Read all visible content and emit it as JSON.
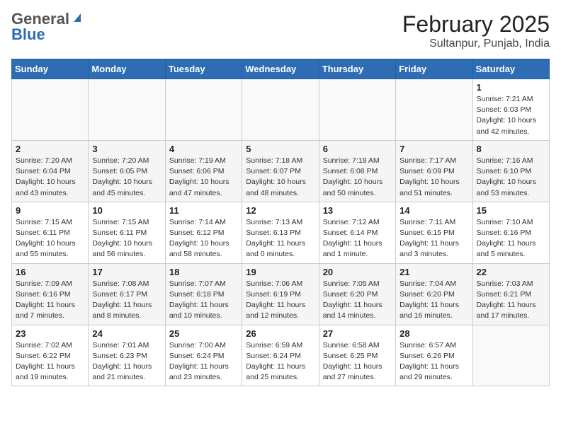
{
  "header": {
    "logo_general": "General",
    "logo_blue": "Blue",
    "title": "February 2025",
    "subtitle": "Sultanpur, Punjab, India"
  },
  "weekdays": [
    "Sunday",
    "Monday",
    "Tuesday",
    "Wednesday",
    "Thursday",
    "Friday",
    "Saturday"
  ],
  "weeks": [
    [
      {
        "day": "",
        "info": ""
      },
      {
        "day": "",
        "info": ""
      },
      {
        "day": "",
        "info": ""
      },
      {
        "day": "",
        "info": ""
      },
      {
        "day": "",
        "info": ""
      },
      {
        "day": "",
        "info": ""
      },
      {
        "day": "1",
        "info": "Sunrise: 7:21 AM\nSunset: 6:03 PM\nDaylight: 10 hours\nand 42 minutes."
      }
    ],
    [
      {
        "day": "2",
        "info": "Sunrise: 7:20 AM\nSunset: 6:04 PM\nDaylight: 10 hours\nand 43 minutes."
      },
      {
        "day": "3",
        "info": "Sunrise: 7:20 AM\nSunset: 6:05 PM\nDaylight: 10 hours\nand 45 minutes."
      },
      {
        "day": "4",
        "info": "Sunrise: 7:19 AM\nSunset: 6:06 PM\nDaylight: 10 hours\nand 47 minutes."
      },
      {
        "day": "5",
        "info": "Sunrise: 7:18 AM\nSunset: 6:07 PM\nDaylight: 10 hours\nand 48 minutes."
      },
      {
        "day": "6",
        "info": "Sunrise: 7:18 AM\nSunset: 6:08 PM\nDaylight: 10 hours\nand 50 minutes."
      },
      {
        "day": "7",
        "info": "Sunrise: 7:17 AM\nSunset: 6:09 PM\nDaylight: 10 hours\nand 51 minutes."
      },
      {
        "day": "8",
        "info": "Sunrise: 7:16 AM\nSunset: 6:10 PM\nDaylight: 10 hours\nand 53 minutes."
      }
    ],
    [
      {
        "day": "9",
        "info": "Sunrise: 7:15 AM\nSunset: 6:11 PM\nDaylight: 10 hours\nand 55 minutes."
      },
      {
        "day": "10",
        "info": "Sunrise: 7:15 AM\nSunset: 6:11 PM\nDaylight: 10 hours\nand 56 minutes."
      },
      {
        "day": "11",
        "info": "Sunrise: 7:14 AM\nSunset: 6:12 PM\nDaylight: 10 hours\nand 58 minutes."
      },
      {
        "day": "12",
        "info": "Sunrise: 7:13 AM\nSunset: 6:13 PM\nDaylight: 11 hours\nand 0 minutes."
      },
      {
        "day": "13",
        "info": "Sunrise: 7:12 AM\nSunset: 6:14 PM\nDaylight: 11 hours\nand 1 minute."
      },
      {
        "day": "14",
        "info": "Sunrise: 7:11 AM\nSunset: 6:15 PM\nDaylight: 11 hours\nand 3 minutes."
      },
      {
        "day": "15",
        "info": "Sunrise: 7:10 AM\nSunset: 6:16 PM\nDaylight: 11 hours\nand 5 minutes."
      }
    ],
    [
      {
        "day": "16",
        "info": "Sunrise: 7:09 AM\nSunset: 6:16 PM\nDaylight: 11 hours\nand 7 minutes."
      },
      {
        "day": "17",
        "info": "Sunrise: 7:08 AM\nSunset: 6:17 PM\nDaylight: 11 hours\nand 8 minutes."
      },
      {
        "day": "18",
        "info": "Sunrise: 7:07 AM\nSunset: 6:18 PM\nDaylight: 11 hours\nand 10 minutes."
      },
      {
        "day": "19",
        "info": "Sunrise: 7:06 AM\nSunset: 6:19 PM\nDaylight: 11 hours\nand 12 minutes."
      },
      {
        "day": "20",
        "info": "Sunrise: 7:05 AM\nSunset: 6:20 PM\nDaylight: 11 hours\nand 14 minutes."
      },
      {
        "day": "21",
        "info": "Sunrise: 7:04 AM\nSunset: 6:20 PM\nDaylight: 11 hours\nand 16 minutes."
      },
      {
        "day": "22",
        "info": "Sunrise: 7:03 AM\nSunset: 6:21 PM\nDaylight: 11 hours\nand 17 minutes."
      }
    ],
    [
      {
        "day": "23",
        "info": "Sunrise: 7:02 AM\nSunset: 6:22 PM\nDaylight: 11 hours\nand 19 minutes."
      },
      {
        "day": "24",
        "info": "Sunrise: 7:01 AM\nSunset: 6:23 PM\nDaylight: 11 hours\nand 21 minutes."
      },
      {
        "day": "25",
        "info": "Sunrise: 7:00 AM\nSunset: 6:24 PM\nDaylight: 11 hours\nand 23 minutes."
      },
      {
        "day": "26",
        "info": "Sunrise: 6:59 AM\nSunset: 6:24 PM\nDaylight: 11 hours\nand 25 minutes."
      },
      {
        "day": "27",
        "info": "Sunrise: 6:58 AM\nSunset: 6:25 PM\nDaylight: 11 hours\nand 27 minutes."
      },
      {
        "day": "28",
        "info": "Sunrise: 6:57 AM\nSunset: 6:26 PM\nDaylight: 11 hours\nand 29 minutes."
      },
      {
        "day": "",
        "info": ""
      }
    ]
  ]
}
